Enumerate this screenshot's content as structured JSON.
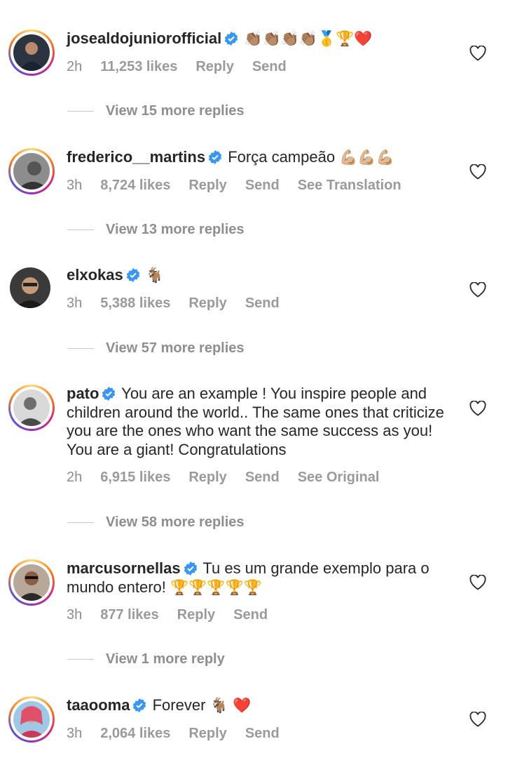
{
  "comments": [
    {
      "username": "josealdojuniorofficial",
      "text": "",
      "emojis": "👏🏽👏🏽👏🏽👏🏽🥇🏆❤️",
      "time": "2h",
      "likes": "11,253 likes",
      "actions": [
        "Reply",
        "Send"
      ],
      "view_replies": "View 15 more replies",
      "avatar_icon": "profile-photo"
    },
    {
      "username": "frederico__martins",
      "text": "Força campeão",
      "emojis": "💪🏼💪🏼💪🏼",
      "time": "3h",
      "likes": "8,724 likes",
      "actions": [
        "Reply",
        "Send",
        "See Translation"
      ],
      "view_replies": "View 13 more replies",
      "avatar_icon": "profile-photo"
    },
    {
      "username": "elxokas",
      "text": "",
      "emojis": "🐐",
      "time": "3h",
      "likes": "5,388 likes",
      "actions": [
        "Reply",
        "Send"
      ],
      "view_replies": "View 57 more replies",
      "avatar_icon": "profile-photo"
    },
    {
      "username": "pato",
      "text": "You are an example ! You inspire people and children around the world.. The same ones that criticize you are the ones who want the same success as you! You are a giant! Congratulations",
      "emojis": "",
      "time": "2h",
      "likes": "6,915 likes",
      "actions": [
        "Reply",
        "Send",
        "See Original"
      ],
      "view_replies": "View 58 more replies",
      "avatar_icon": "profile-photo"
    },
    {
      "username": "marcusornellas",
      "text": "Tu es um grande exemplo para o mundo entero!",
      "emojis": "🏆🏆🏆🏆🏆",
      "time": "3h",
      "likes": "877 likes",
      "actions": [
        "Reply",
        "Send"
      ],
      "view_replies": "View 1 more reply",
      "avatar_icon": "profile-photo"
    },
    {
      "username": "taaooma",
      "text": "Forever",
      "emojis": "🐐 ❤️",
      "time": "3h",
      "likes": "2,064 likes",
      "actions": [
        "Reply",
        "Send"
      ],
      "view_replies": "",
      "avatar_icon": "profile-photo"
    }
  ],
  "colors": {
    "verified": "#3897f0",
    "meta": "#8e8e8e",
    "text": "#262626"
  },
  "icons": {
    "verified": "verified-badge-icon",
    "like": "heart-outline-icon"
  }
}
